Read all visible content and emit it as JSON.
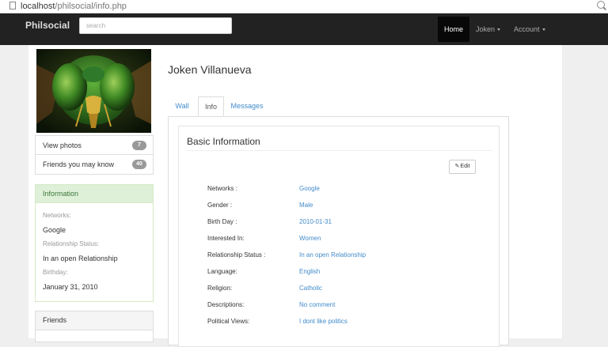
{
  "browser": {
    "url_host": "localhost",
    "url_path": "/philsocial/info.php"
  },
  "navbar": {
    "brand": "Philsocial",
    "search_placeholder": "search",
    "home": "Home",
    "user": "Joken",
    "account": "Account"
  },
  "sidebar": {
    "links": [
      {
        "label": "View photos",
        "badge": "7"
      },
      {
        "label": "Friends you may know",
        "badge": "40"
      }
    ],
    "info_panel": {
      "title": "Information",
      "items": [
        {
          "label": "Networks:",
          "value": "Google"
        },
        {
          "label": "Relationship Status:",
          "value": "In an open Relationship"
        },
        {
          "label": "Birthday:",
          "value": "January 31, 2010"
        }
      ]
    },
    "friends_title": "Friends"
  },
  "profile": {
    "name": "Joken Villanueva",
    "tabs": [
      "Wall",
      "Info",
      "Messages"
    ],
    "active_tab": "Info"
  },
  "basic_info": {
    "title": "Basic Information",
    "edit_label": "Edit",
    "rows": [
      {
        "label": "Networks :",
        "value": "Google"
      },
      {
        "label": "Gender :",
        "value": "Male"
      },
      {
        "label": "Birth Day :",
        "value": "2010-01-31"
      },
      {
        "label": "Interested In:",
        "value": "Women"
      },
      {
        "label": "Relationship Status :",
        "value": "In an open Relationship"
      },
      {
        "label": "Language:",
        "value": "English"
      },
      {
        "label": "Religion:",
        "value": "Catholic"
      },
      {
        "label": "Descriptions:",
        "value": "No comment"
      },
      {
        "label": "Political Views:",
        "value": "I dont like politics"
      }
    ]
  }
}
